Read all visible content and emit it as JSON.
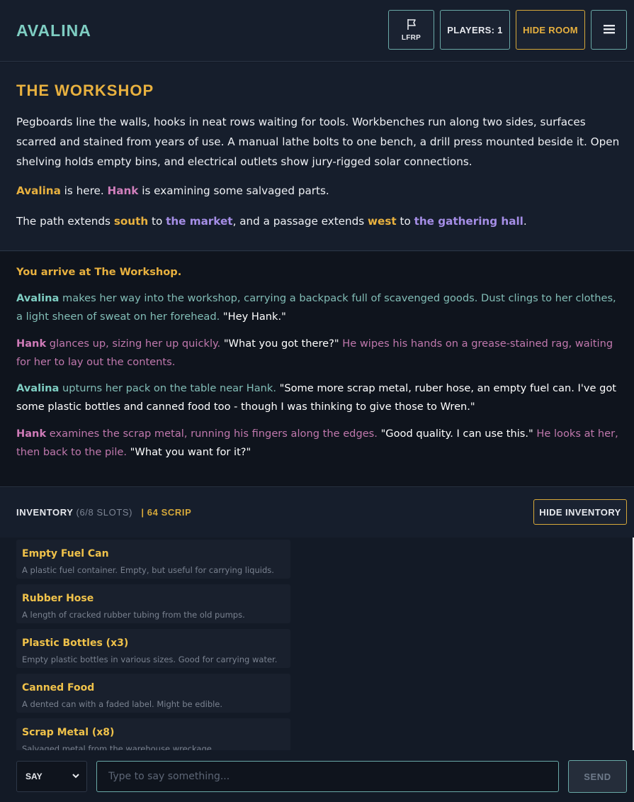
{
  "header": {
    "brand": "AVALINA",
    "lfrp_label": "LFRP",
    "players_label": "PLAYERS: 1",
    "hide_room_label": "HIDE ROOM",
    "menu_icon": "hamburger-icon",
    "flag_icon": "flag-icon"
  },
  "room": {
    "title": "THE WORKSHOP",
    "description": "Pegboards line the walls, hooks in neat rows waiting for tools. Workbenches run along two sides, surfaces scarred and stained from years of use. A manual lathe bolts to one bench, a drill press mounted beside it. Open shelving holds empty bins, and electrical outlets show jury-rigged solar connections.",
    "presence": {
      "player": "Avalina",
      "player_suffix": " is here. ",
      "npc": "Hank",
      "npc_suffix": " is examining some salvaged parts."
    },
    "exits": {
      "prefix": "The path extends ",
      "dir1": "south",
      "to1": " to ",
      "dest1": "the market",
      "mid": ", and a passage extends ",
      "dir2": "west",
      "to2": " to ",
      "dest2": "the gathering hall",
      "end": "."
    }
  },
  "log": {
    "arrive": "You arrive at The Workshop.",
    "entries": [
      {
        "name": "Avalina",
        "action": " makes her way into the workshop, carrying a backpack full of scavenged goods. Dust clings to her clothes, a light sheen of sweat on her forehead. ",
        "speech": "\"Hey Hank.\""
      },
      {
        "name": "Hank",
        "action": " glances up, sizing her up quickly. ",
        "speech": "\"What you got there?\"",
        "action2": " He wipes his hands on a grease-stained rag, waiting for her to lay out the contents."
      },
      {
        "name": "Avalina",
        "action": " upturns her pack on the table near Hank. ",
        "speech": "\"Some more scrap metal, ruber hose, an empty fuel can. I've got some plastic bottles and canned food too - though I was thinking to give those to Wren.\""
      },
      {
        "name": "Hank",
        "action": " examines the scrap metal, running his fingers along the edges. ",
        "speech": "\"Good quality. I can use this.\"",
        "action2": " He looks at her, then back to the pile. ",
        "speech2": "\"What you want for it?\""
      }
    ]
  },
  "inventory": {
    "label": "INVENTORY",
    "slots": "(6/8 SLOTS)",
    "scrip": "| 64 SCRIP",
    "hide_label": "HIDE INVENTORY",
    "items": [
      {
        "name": "Empty Fuel Can",
        "desc": "A plastic fuel container. Empty, but useful for carrying liquids."
      },
      {
        "name": "Rubber Hose",
        "desc": "A length of cracked rubber tubing from the old pumps."
      },
      {
        "name": "Plastic Bottles (x3)",
        "desc": "Empty plastic bottles in various sizes. Good for carrying water."
      },
      {
        "name": "Canned Food",
        "desc": "A dented can with a faded label. Might be edible."
      },
      {
        "name": "Scrap Metal (x8)",
        "desc": "Salvaged metal from the warehouse wreckage."
      }
    ]
  },
  "input": {
    "mode": "SAY",
    "placeholder": "Type to say something...",
    "send_label": "SEND"
  },
  "colors": {
    "accent_teal": "#7ecdc2",
    "accent_gold": "#e8b13f",
    "npc_pink": "#cf7bb8",
    "link_purple": "#a58ee6",
    "background": "#131a26"
  }
}
